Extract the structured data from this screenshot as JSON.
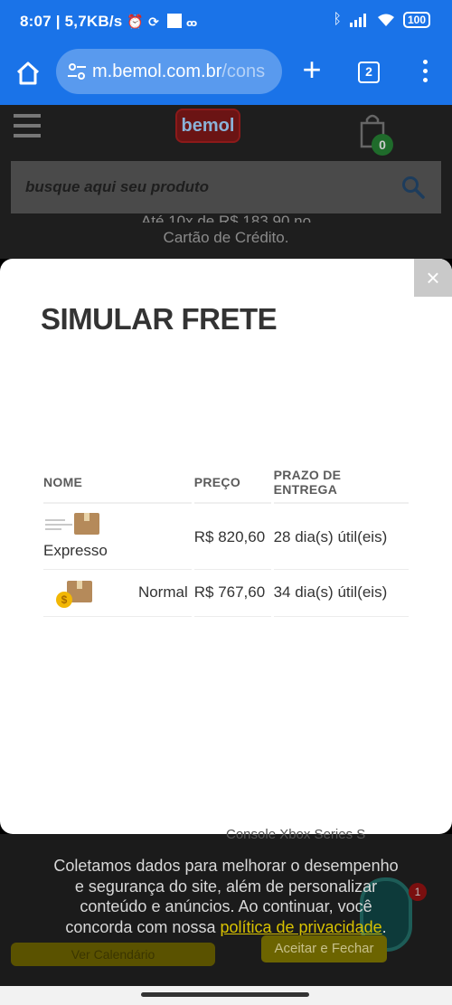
{
  "statusbar": {
    "time": "8:07 | 5,7KB/s",
    "battery": "100",
    "icons": [
      "alarm-icon",
      "nfc-icon",
      "notification-square-icon",
      "voicemail-icon",
      "bluetooth-icon",
      "signal-icon",
      "wifi-icon",
      "battery-icon"
    ]
  },
  "browser": {
    "url_host": "m.bemol.com.br",
    "url_path": "/cons",
    "tab_count": "2",
    "colors": {
      "toolbar": "#1a73e8"
    }
  },
  "site_header": {
    "logo_text": "bemol",
    "cart_count": "0",
    "search_placeholder": "busque aqui seu produto",
    "installment_line1": "Até 10x de R$ 183,90 no",
    "installment_line2": "Cartão de Crédito."
  },
  "modal": {
    "title": "SIMULAR FRETE",
    "close_label": "×",
    "table": {
      "headers": [
        "NOME",
        "PREÇO",
        "PRAZO DE ENTREGA"
      ],
      "rows": [
        {
          "name": "Expresso",
          "price": "R$ 820,60",
          "deadline": "28 dia(s) útil(eis)",
          "icon": "express-delivery-icon"
        },
        {
          "name": "Normal",
          "price": "R$ 767,60",
          "deadline": "34 dia(s) útil(eis)",
          "icon": "standard-delivery-icon"
        }
      ]
    }
  },
  "background_page": {
    "product_text": "Console Xbox Series S",
    "buy_button": "Ver Calendário",
    "notification_badge": "1"
  },
  "cookie_banner": {
    "text": "Coletamos dados para melhorar o desempenho e segurança do site, além de personalizar conteúdo e anúncios. Ao continuar, você concorda com nossa",
    "link": "política de privacidade",
    "link_suffix": ".",
    "accept_button": "Aceitar e Fechar",
    "colors": {
      "link": "#d8c200",
      "button": "#6c6400"
    }
  }
}
